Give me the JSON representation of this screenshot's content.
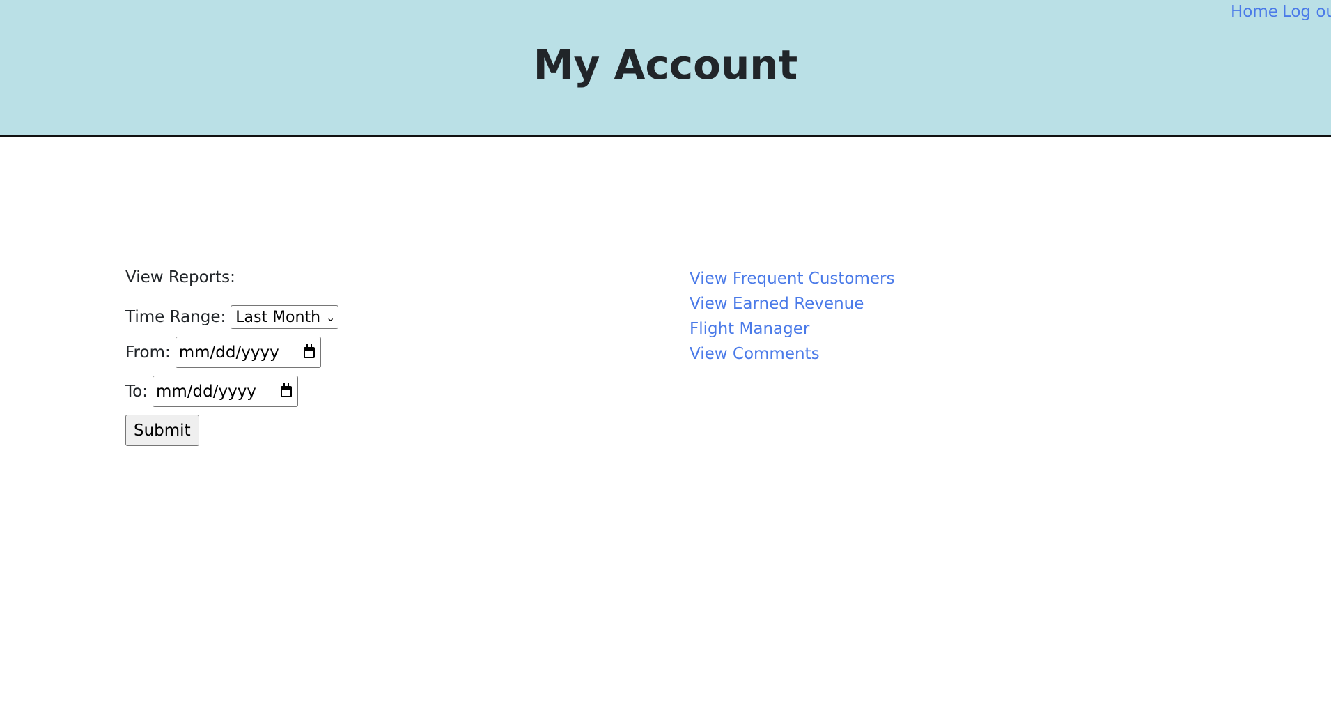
{
  "header": {
    "title": "My Account",
    "nav": {
      "home_label": "Home",
      "logout_label": "Log out"
    }
  },
  "reports": {
    "heading": "View Reports:",
    "time_range": {
      "label": "Time Range:",
      "selected": "Last Month"
    },
    "from": {
      "label": "From:",
      "value": "mm/dd/yyyy"
    },
    "to": {
      "label": "To:",
      "value": "mm/dd/yyyy"
    },
    "submit_label": "Submit"
  },
  "links": [
    {
      "label": "View Frequent Customers"
    },
    {
      "label": "View Earned Revenue"
    },
    {
      "label": "Flight Manager"
    },
    {
      "label": "View Comments"
    }
  ],
  "colors": {
    "header_bg": "#bae0e6",
    "link": "#4a7ae8",
    "title_text": "#212529"
  },
  "icons": {
    "select_arrow": "chevron-down-icon",
    "date_picker": "calendar-icon"
  }
}
